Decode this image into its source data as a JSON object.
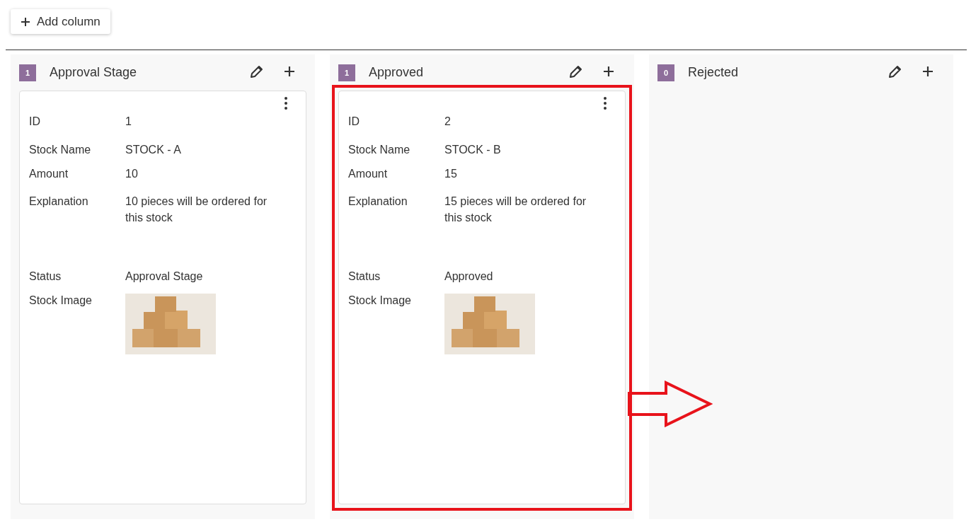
{
  "toolbar": {
    "add_button": "Add column"
  },
  "columns": [
    {
      "count": "1",
      "title": "Approval Stage",
      "cards": [
        {
          "highlighted": false,
          "fields": [
            {
              "label": "ID",
              "value": "1"
            },
            {
              "label": "Stock Name",
              "value": "STOCK - A"
            },
            {
              "label": "Amount",
              "value": "10"
            },
            {
              "label": "Explanation",
              "value": "10 pieces will be ordered for this stock"
            },
            {
              "label": "Status",
              "value": "Approval Stage"
            }
          ],
          "image_label": "Stock Image"
        }
      ]
    },
    {
      "count": "1",
      "title": "Approved",
      "cards": [
        {
          "highlighted": true,
          "fields": [
            {
              "label": "ID",
              "value": "2"
            },
            {
              "label": "Stock Name",
              "value": "STOCK - B"
            },
            {
              "label": "Amount",
              "value": "15"
            },
            {
              "label": "Explanation",
              "value": "15 pieces will be ordered for this stock"
            },
            {
              "label": "Status",
              "value": "Approved"
            }
          ],
          "image_label": "Stock Image"
        }
      ]
    },
    {
      "count": "0",
      "title": "Rejected"
    }
  ]
}
